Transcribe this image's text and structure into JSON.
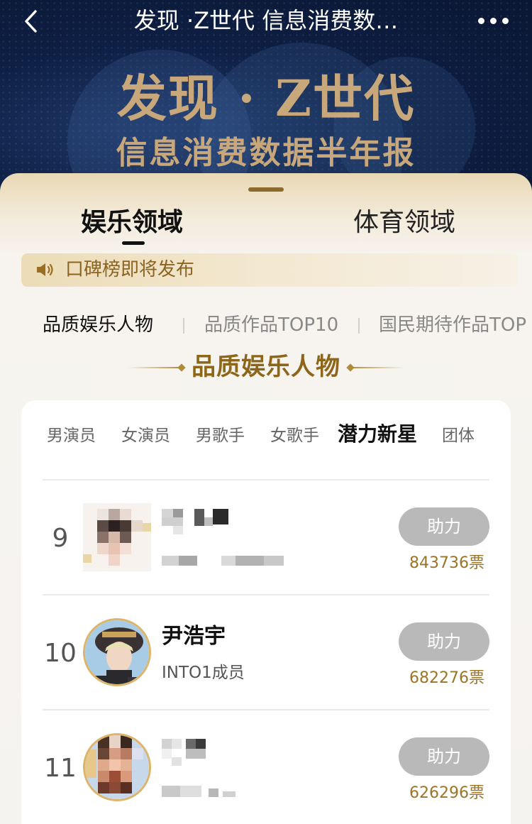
{
  "nav": {
    "title": "发现 ·Z世代 信息消费数…",
    "back_icon": "chevron-left-icon",
    "more_icon": "more-dots-icon"
  },
  "hero": {
    "title": "发现 · Z世代",
    "subtitle": "信息消费数据半年报",
    "title_color": "#c8a77a"
  },
  "tabs": [
    {
      "label": "娱乐领域",
      "active": true
    },
    {
      "label": "体育领域",
      "active": false
    }
  ],
  "notice": {
    "icon": "speaker-icon",
    "text": "口碑榜即将发布"
  },
  "subtabs": [
    {
      "label": "品质娱乐人物",
      "active": true
    },
    {
      "label": "品质作品TOP10",
      "active": false
    },
    {
      "label": "国民期待作品TOP",
      "active": false
    }
  ],
  "section": {
    "title": "品质娱乐人物"
  },
  "categories": [
    {
      "label": "男演员",
      "active": false
    },
    {
      "label": "女演员",
      "active": false
    },
    {
      "label": "男歌手",
      "active": false
    },
    {
      "label": "女歌手",
      "active": false
    },
    {
      "label": "潜力新星",
      "active": true
    },
    {
      "label": "团体",
      "active": false
    }
  ],
  "entries": [
    {
      "rank": "9",
      "name": "",
      "subtitle": "",
      "button": "助力",
      "votes": "843736票",
      "blurred": true
    },
    {
      "rank": "10",
      "name": "尹浩宇",
      "subtitle": "INTO1成员",
      "button": "助力",
      "votes": "682276票",
      "blurred": false
    },
    {
      "rank": "11",
      "name": "",
      "subtitle": "",
      "button": "助力",
      "votes": "626296票",
      "blurred": true
    }
  ],
  "colors": {
    "accent_gold": "#8e6619",
    "votes_gold": "#9c7428",
    "button_grey": "#b9b9b9",
    "hero_bg": "#0e1f44"
  }
}
